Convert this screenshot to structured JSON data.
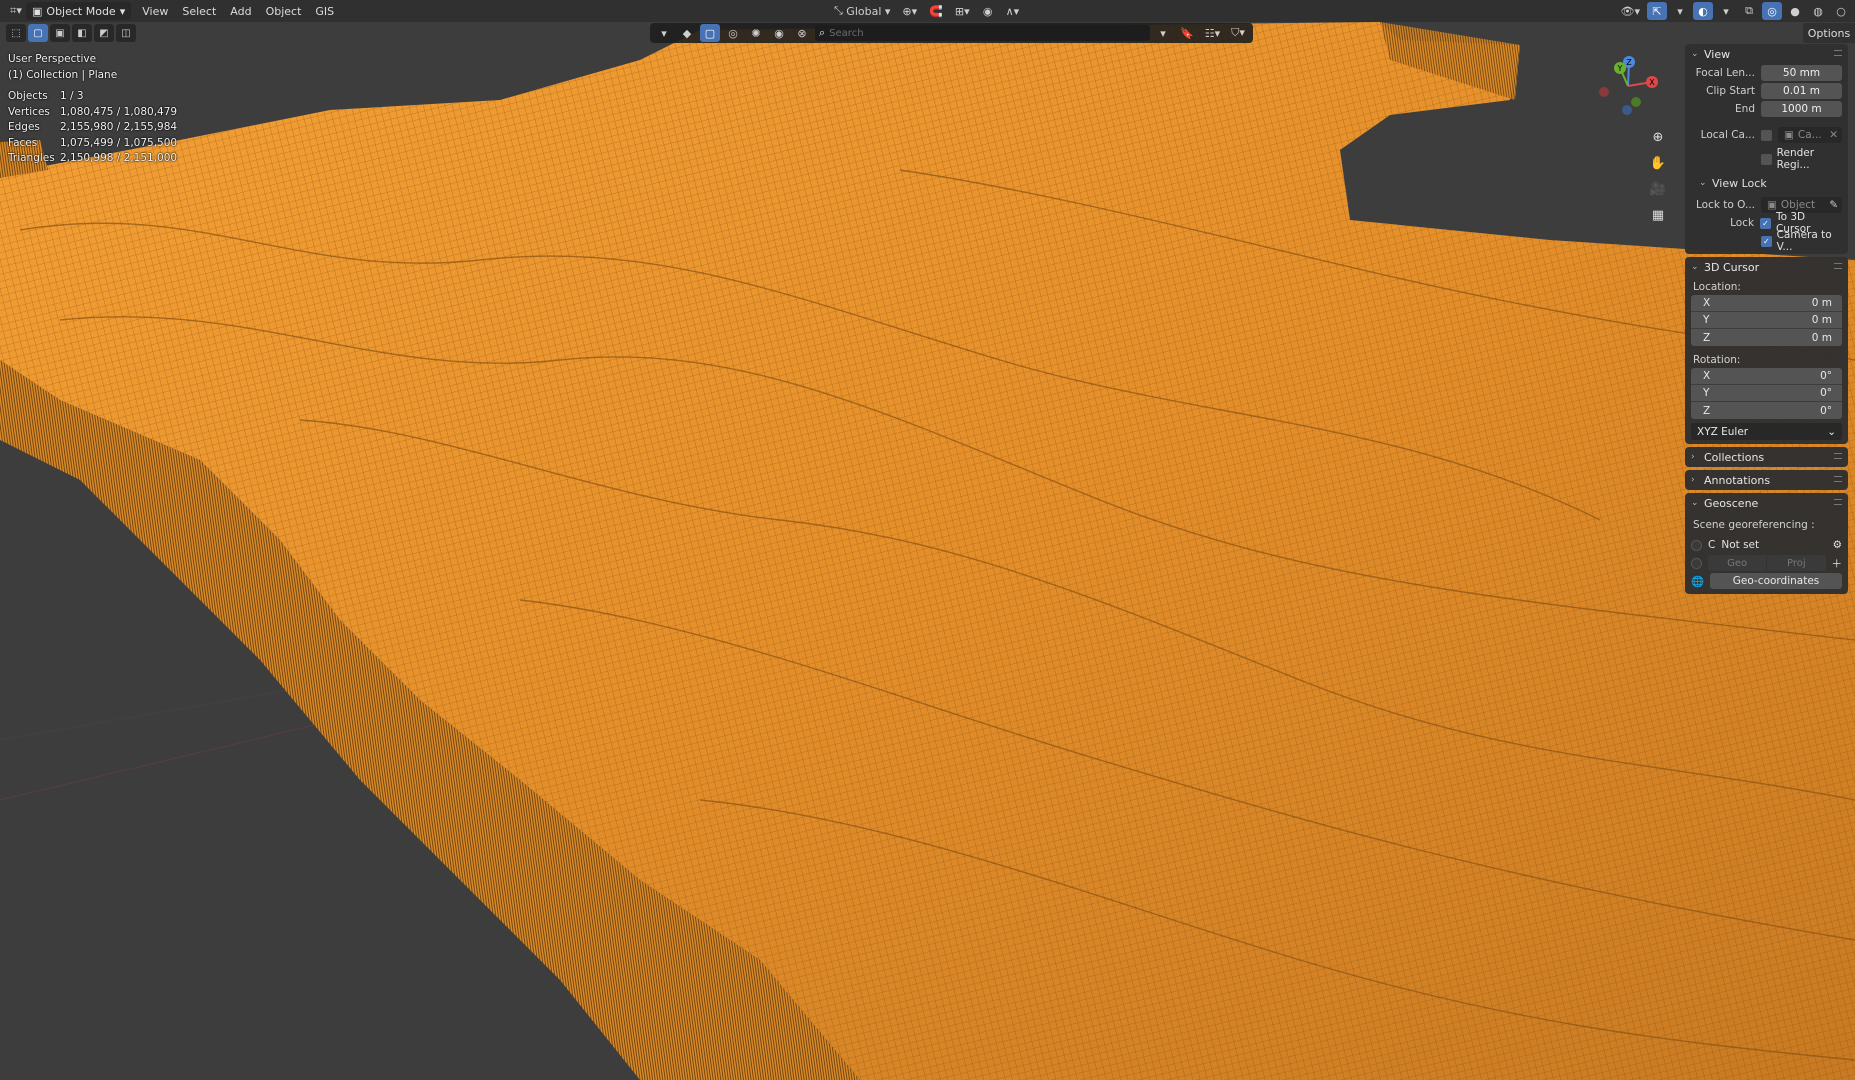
{
  "colors": {
    "wire": "#f0962a",
    "viewport_bg": "#3d3d3d",
    "accent": "#4772b3"
  },
  "header": {
    "mode": "Object Mode",
    "menus": [
      "View",
      "Select",
      "Add",
      "Object",
      "GIS"
    ],
    "transform_orientation": "Global",
    "options_label": "Options"
  },
  "search": {
    "placeholder": "Search"
  },
  "overlay": {
    "view_name": "User Perspective",
    "collection": "(1) Collection | Plane",
    "stats": [
      {
        "label": "Objects",
        "value": "1 / 3"
      },
      {
        "label": "Vertices",
        "value": "1,080,475 / 1,080,479"
      },
      {
        "label": "Edges",
        "value": "2,155,980 / 2,155,984"
      },
      {
        "label": "Faces",
        "value": "1,075,499 / 1,075,500"
      },
      {
        "label": "Triangles",
        "value": "2,150,998 / 2,151,000"
      }
    ]
  },
  "gizmo": {
    "x": "X",
    "y": "Y",
    "z": "Z"
  },
  "sidebar": {
    "view": {
      "title": "View",
      "focal_label": "Focal Len...",
      "focal_value": "50 mm",
      "clip_start_label": "Clip Start",
      "clip_start_value": "0.01 m",
      "end_label": "End",
      "end_value": "1000 m",
      "local_cam_label": "Local Ca...",
      "local_cam_value": "Ca...",
      "render_region_label": "Render Regi...",
      "view_lock_title": "View Lock",
      "lock_to_label": "Lock to O...",
      "lock_to_placeholder": "Object",
      "lock_label": "Lock",
      "to_cursor_label": "To 3D Cursor",
      "camera_to_view_label": "Camera to V..."
    },
    "cursor": {
      "title": "3D Cursor",
      "location_label": "Location:",
      "location": [
        {
          "axis": "X",
          "value": "0 m"
        },
        {
          "axis": "Y",
          "value": "0 m"
        },
        {
          "axis": "Z",
          "value": "0 m"
        }
      ],
      "rotation_label": "Rotation:",
      "rotation": [
        {
          "axis": "X",
          "value": "0°"
        },
        {
          "axis": "Y",
          "value": "0°"
        },
        {
          "axis": "Z",
          "value": "0°"
        }
      ],
      "rotation_mode": "XYZ Euler"
    },
    "collections": {
      "title": "Collections"
    },
    "annotations": {
      "title": "Annotations"
    },
    "geoscene": {
      "title": "Geoscene",
      "georef_label": "Scene georeferencing :",
      "crs_prefix": "C",
      "crs_value": "Not set",
      "geo_label": "Geo",
      "proj_label": "Proj",
      "geo_coords_label": "Geo-coordinates"
    }
  }
}
